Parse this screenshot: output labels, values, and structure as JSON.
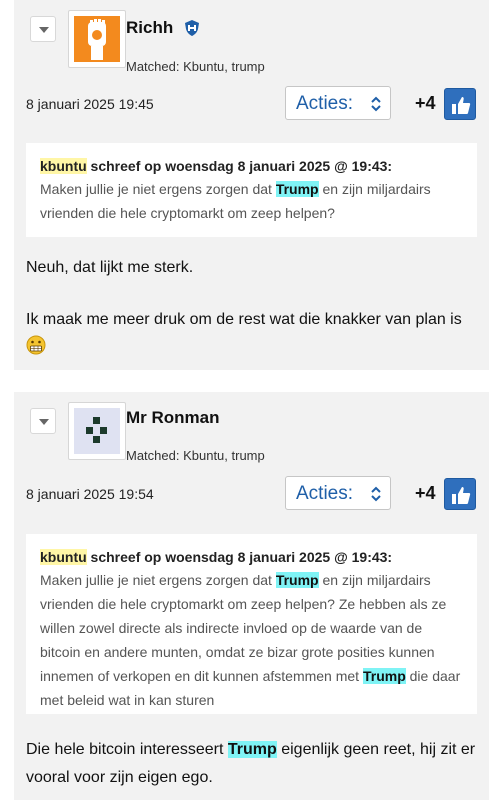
{
  "posts": [
    {
      "username": "Richh",
      "matched": "Matched: Kbuntu, trump",
      "date": "8 januari 2025 19:45",
      "acties_label": "Acties:",
      "score": "+4",
      "quote": {
        "author": "kbuntu",
        "header_rest": " schreef op woensdag 8 januari 2025 @ 19:43:",
        "text_before": "Maken jullie je niet ergens zorgen dat ",
        "highlight": "Trump",
        "text_after": " en zijn miljardairs vrienden die hele cryptomarkt om zeep helpen?"
      },
      "body_line1": "Neuh, dat lijkt me sterk.",
      "body_line2": "Ik maak me meer druk om de rest wat die knakker van plan is"
    },
    {
      "username": "Mr Ronman",
      "matched": "Matched: Kbuntu, trump",
      "date": "8 januari 2025 19:54",
      "acties_label": "Acties:",
      "score": "+4",
      "quote": {
        "author": "kbuntu",
        "header_rest": " schreef op woensdag 8 januari 2025 @ 19:43:",
        "text_before": "Maken jullie je niet ergens zorgen dat ",
        "highlight": "Trump",
        "text_mid": " en zijn miljardairs vrienden die hele cryptomarkt om zeep helpen? Ze hebben als ze willen zowel directe als indirecte invloed op de waarde van de bitcoin en andere munten, omdat ze bizar grote posities kunnen innemen of verkopen en dit kunnen afstemmen met ",
        "highlight2": "Trump",
        "text_after": " die daar met beleid wat in kan sturen"
      },
      "body_before": "Die hele bitcoin interesseert ",
      "body_highlight": "Trump",
      "body_after": " eigenlijk geen reet, hij zit er vooral voor zijn eigen ego."
    }
  ],
  "colors": {
    "accent": "#1f5fa8",
    "like_button": "#2f6fbd",
    "highlight": "#7ff3f5",
    "name_highlight": "#fff6a6"
  },
  "icons": [
    "collapse-arrow-icon",
    "shield-icon",
    "chevron-updown-icon",
    "thumbs-up-icon",
    "grimace-emoji-icon"
  ]
}
